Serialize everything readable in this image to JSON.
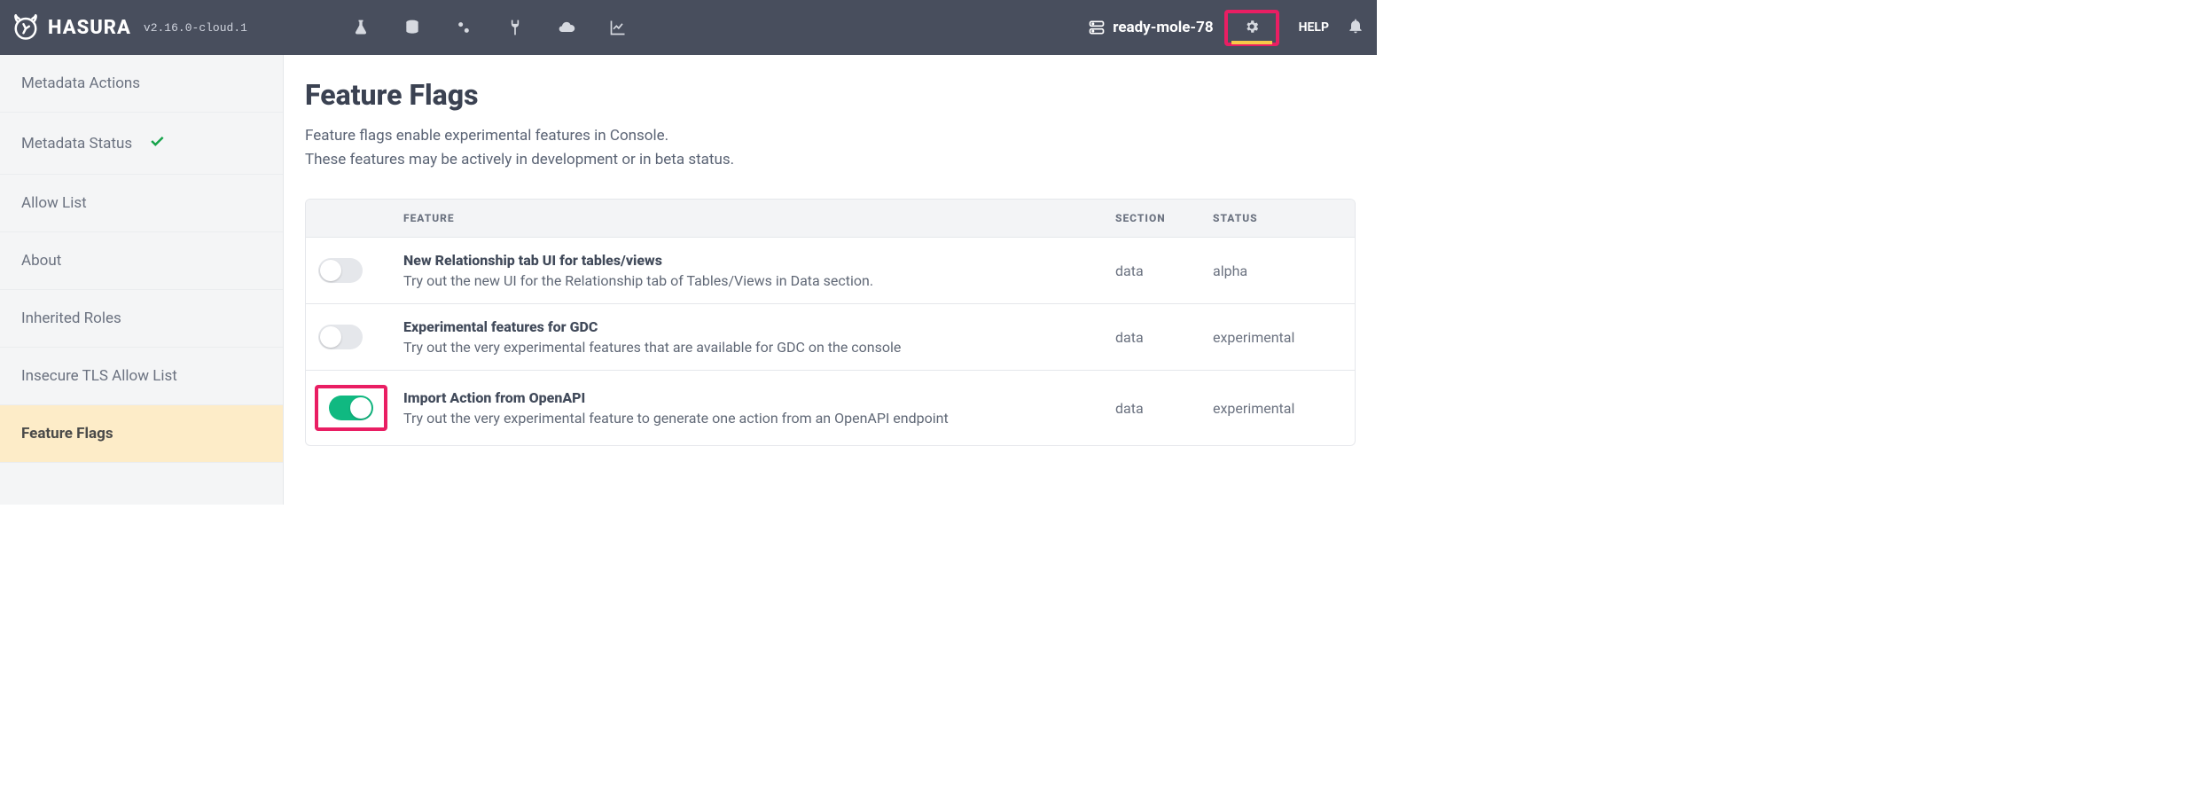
{
  "brand": {
    "name": "HASURA",
    "version": "v2.16.0-cloud.1"
  },
  "nav_right": {
    "project": "ready-mole-78",
    "help": "HELP"
  },
  "sidebar": {
    "items": [
      {
        "label": "Metadata Actions"
      },
      {
        "label": "Metadata Status"
      },
      {
        "label": "Allow List"
      },
      {
        "label": "About"
      },
      {
        "label": "Inherited Roles"
      },
      {
        "label": "Insecure TLS Allow List"
      },
      {
        "label": "Feature Flags"
      }
    ]
  },
  "page": {
    "title": "Feature Flags",
    "desc_line1": "Feature flags enable experimental features in Console.",
    "desc_line2": "These features may be actively in development or in beta status."
  },
  "table": {
    "headers": {
      "feature": "FEATURE",
      "section": "SECTION",
      "status": "STATUS"
    },
    "rows": [
      {
        "title": "New Relationship tab UI for tables/views",
        "desc": "Try out the new UI for the Relationship tab of Tables/Views in Data section.",
        "section": "data",
        "status": "alpha",
        "enabled": false,
        "highlight": false
      },
      {
        "title": "Experimental features for GDC",
        "desc": "Try out the very experimental features that are available for GDC on the console",
        "section": "data",
        "status": "experimental",
        "enabled": false,
        "highlight": false
      },
      {
        "title": "Import Action from OpenAPI",
        "desc": "Try out the very experimental feature to generate one action from an OpenAPI endpoint",
        "section": "data",
        "status": "experimental",
        "enabled": true,
        "highlight": true
      }
    ]
  }
}
